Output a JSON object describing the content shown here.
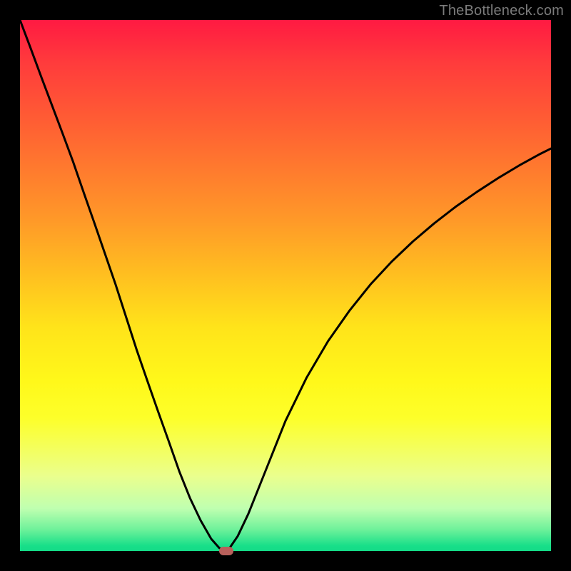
{
  "watermark": {
    "text": "TheBottleneck.com"
  },
  "chart_data": {
    "type": "line",
    "title": "",
    "xlabel": "",
    "ylabel": "",
    "x": [
      0.0,
      0.02,
      0.04,
      0.06,
      0.08,
      0.1,
      0.12,
      0.14,
      0.16,
      0.18,
      0.2,
      0.22,
      0.24,
      0.26,
      0.28,
      0.3,
      0.32,
      0.34,
      0.36,
      0.375,
      0.385,
      0.395,
      0.41,
      0.43,
      0.46,
      0.5,
      0.54,
      0.58,
      0.62,
      0.66,
      0.7,
      0.74,
      0.78,
      0.82,
      0.86,
      0.9,
      0.94,
      0.98,
      1.0
    ],
    "series": [
      {
        "name": "bottleneck-curve",
        "values": [
          1.0,
          0.947,
          0.893,
          0.84,
          0.787,
          0.733,
          0.675,
          0.618,
          0.56,
          0.502,
          0.44,
          0.378,
          0.32,
          0.263,
          0.207,
          0.15,
          0.1,
          0.058,
          0.023,
          0.006,
          0.0,
          0.006,
          0.028,
          0.07,
          0.145,
          0.245,
          0.327,
          0.395,
          0.452,
          0.502,
          0.545,
          0.583,
          0.617,
          0.648,
          0.676,
          0.702,
          0.726,
          0.748,
          0.758
        ]
      }
    ],
    "xlim": [
      0,
      1
    ],
    "ylim": [
      0,
      1
    ],
    "grid": false,
    "marker": {
      "x": 0.388,
      "y": 0.0,
      "color": "#b8605b"
    },
    "background_gradient": {
      "stops": [
        {
          "pos": 0.0,
          "color": "#ff1a42"
        },
        {
          "pos": 0.5,
          "color": "#ffe41a"
        },
        {
          "pos": 0.8,
          "color": "#f5ff57"
        },
        {
          "pos": 0.96,
          "color": "#6df19a"
        },
        {
          "pos": 1.0,
          "color": "#14db87"
        }
      ]
    }
  }
}
